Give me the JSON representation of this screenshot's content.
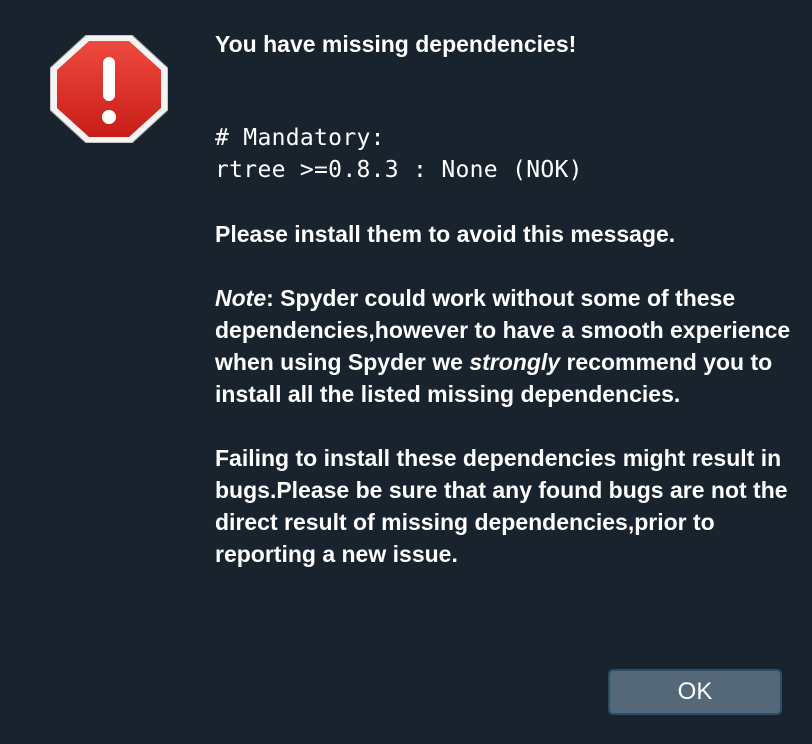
{
  "dialog": {
    "icon": "error-stop-icon",
    "title": "You have missing dependencies!",
    "code_lines": [
      "# Mandatory:",
      "rtree >=0.8.3 : None (NOK)"
    ],
    "install_message": "Please install them to avoid this message.",
    "note": {
      "label": "Note",
      "text_1": ": Spyder could work without some of these dependencies,however to have a smooth experience when using Spyder we ",
      "emphasis": "strongly",
      "text_2": " recommend you to install all the listed missing dependencies."
    },
    "failing_message": "Failing to install these dependencies might result in bugs.Please be sure that any found bugs are not the direct result of missing dependencies,prior to reporting a new issue.",
    "ok_label": "OK"
  },
  "colors": {
    "background": "#19232d",
    "icon_red": "#d92a23",
    "button_bg": "#54687a",
    "button_border": "#2b4d66"
  }
}
